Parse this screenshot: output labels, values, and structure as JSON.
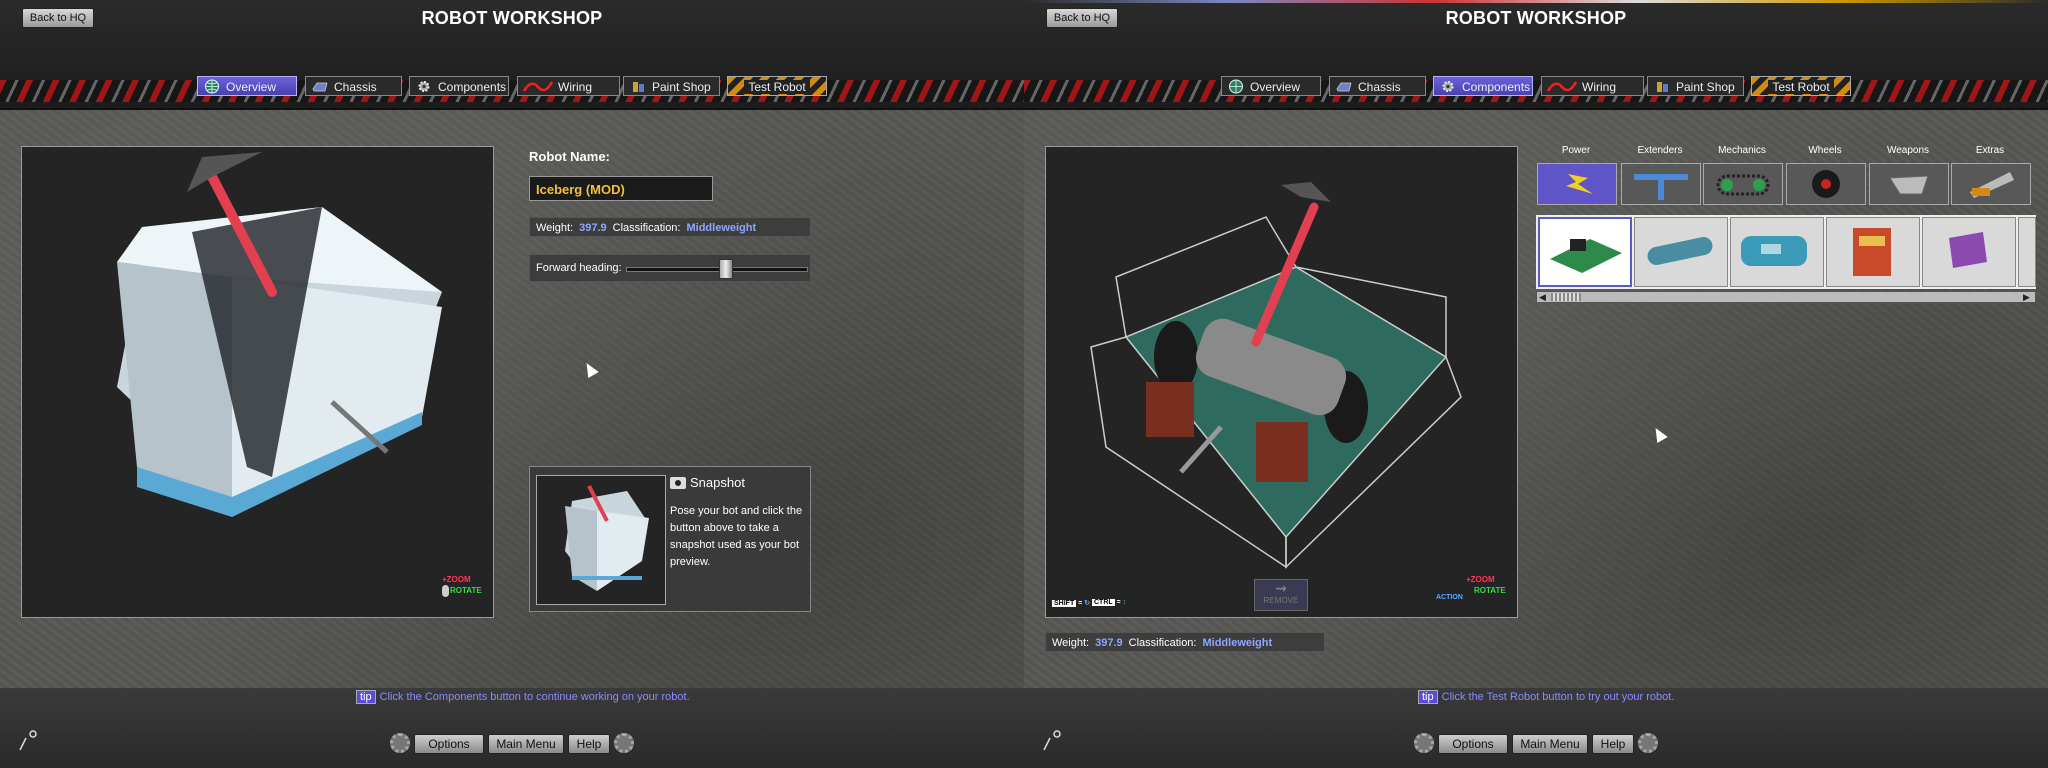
{
  "left": {
    "back_label": "Back to HQ",
    "title": "ROBOT WORKSHOP",
    "tabs": [
      {
        "label": "Overview",
        "icon": "globe-icon",
        "active": true
      },
      {
        "label": "Chassis",
        "icon": "chassis-icon",
        "active": false
      },
      {
        "label": "Components",
        "icon": "gear-icon",
        "active": false
      },
      {
        "label": "Wiring",
        "icon": "wire-icon",
        "active": false
      },
      {
        "label": "Paint Shop",
        "icon": "paint-icon",
        "active": false
      },
      {
        "label": "Test Robot",
        "icon": "hazard-icon",
        "active": false
      }
    ],
    "robot_name_label": "Robot Name:",
    "robot_name_value": "Iceberg (MOD)",
    "weight_label": "Weight:",
    "weight_value": "397.9",
    "classification_label": "Classification:",
    "classification_value": "Middleweight",
    "heading_label": "Forward heading:",
    "heading_level": 0.55,
    "snapshot_title": "Snapshot",
    "snapshot_desc": "Pose your bot and click the button above to take a snapshot used as your bot preview.",
    "zoom_label": "ZOOM",
    "rotate_label": "ROTATE",
    "tip_badge": "tip",
    "tip_text": "Click the Components button to continue working on your robot."
  },
  "right": {
    "back_label": "Back to HQ",
    "title": "ROBOT WORKSHOP",
    "tabs": [
      {
        "label": "Overview",
        "icon": "globe-icon",
        "active": false
      },
      {
        "label": "Chassis",
        "icon": "chassis-icon",
        "active": false
      },
      {
        "label": "Components",
        "icon": "gear-icon",
        "active": true
      },
      {
        "label": "Wiring",
        "icon": "wire-icon",
        "active": false
      },
      {
        "label": "Paint Shop",
        "icon": "paint-icon",
        "active": false
      },
      {
        "label": "Test Robot",
        "icon": "hazard-icon",
        "active": false
      }
    ],
    "categories": [
      "Power",
      "Extenders",
      "Mechanics",
      "Wheels",
      "Weapons",
      "Extras"
    ],
    "active_category": "Power",
    "remove_label": "REMOVE",
    "shift_label": "SHIFT",
    "ctrl_label": "CTRL",
    "action_label": "ACTION",
    "zoom_label": "ZOOM",
    "rotate_label": "ROTATE",
    "weight_label": "Weight:",
    "weight_value": "397.9",
    "classification_label": "Classification:",
    "classification_value": "Middleweight",
    "tip_badge": "tip",
    "tip_text": "Click the Test Robot button to try out your robot."
  },
  "footer": {
    "options_label": "Options",
    "main_menu_label": "Main Menu",
    "help_label": "Help"
  },
  "colors": {
    "accent_purple": "#5c4bd6",
    "value_blue": "#8ea6ff",
    "name_gold": "#f3c03a",
    "hint_red": "#ff3355",
    "hint_green": "#33dd44"
  }
}
